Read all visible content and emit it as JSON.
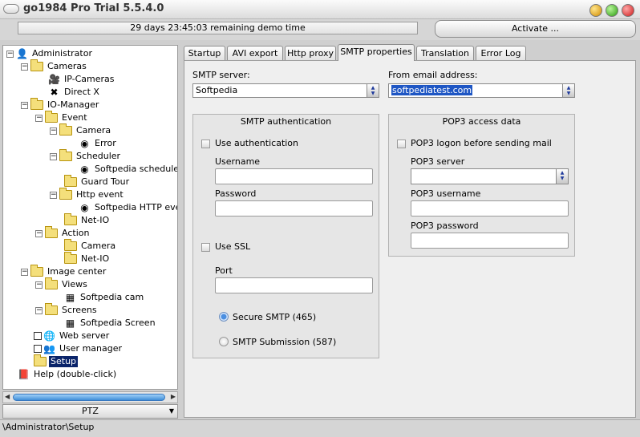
{
  "window": {
    "title": "go1984 Pro Trial 5.5.4.0"
  },
  "topbar": {
    "demo_remaining": "29 days 23:45:03 remaining demo time",
    "activate_label": "Activate ..."
  },
  "tree": {
    "administrator": "Administrator",
    "cameras": "Cameras",
    "ip_cameras": "IP-Cameras",
    "direct_x": "Direct X",
    "io_manager": "IO-Manager",
    "event": "Event",
    "event_camera": "Camera",
    "error": "Error",
    "scheduler": "Scheduler",
    "softpedia_schedule": "Softpedia schedule",
    "guard_tour": "Guard Tour",
    "http_event": "Http event",
    "softpedia_http_event": "Softpedia HTTP event",
    "event_net_io": "Net-IO",
    "action": "Action",
    "action_camera": "Camera",
    "action_net_io": "Net-IO",
    "image_center": "Image center",
    "views": "Views",
    "softpedia_cam": "Softpedia cam",
    "screens": "Screens",
    "softpedia_screen": "Softpedia Screen",
    "web_server": "Web server",
    "user_manager": "User manager",
    "setup": "Setup",
    "help": "Help (double-click)"
  },
  "ptz": {
    "label": "PTZ"
  },
  "statusbar": {
    "path": "\\Administrator\\Setup"
  },
  "tabs": {
    "startup": "Startup",
    "avi_export": "AVI export",
    "http_proxy": "Http proxy",
    "smtp_properties": "SMTP properties",
    "translation": "Translation",
    "error_log": "Error Log"
  },
  "smtp": {
    "server_label": "SMTP server:",
    "server_value": "Softpedia",
    "from_label": "From email address:",
    "from_value": "softpediatest.com",
    "auth_title": "SMTP authentication",
    "use_auth_label": "Use authentication",
    "username_label": "Username",
    "username_value": "",
    "password_label": "Password",
    "password_value": "",
    "use_ssl_label": "Use SSL",
    "port_label": "Port",
    "port_value": "",
    "secure_smtp_label": "Secure SMTP (465)",
    "submission_label": "SMTP Submission (587)"
  },
  "pop3": {
    "title": "POP3 access data",
    "logon_label": "POP3 logon before sending mail",
    "server_label": "POP3 server",
    "server_value": "",
    "username_label": "POP3 username",
    "username_value": "",
    "password_label": "POP3 password",
    "password_value": ""
  },
  "colors": {
    "selection": "#0a246a",
    "highlight": "#1e56c4",
    "scroll_thumb": "#3f8ed8"
  }
}
